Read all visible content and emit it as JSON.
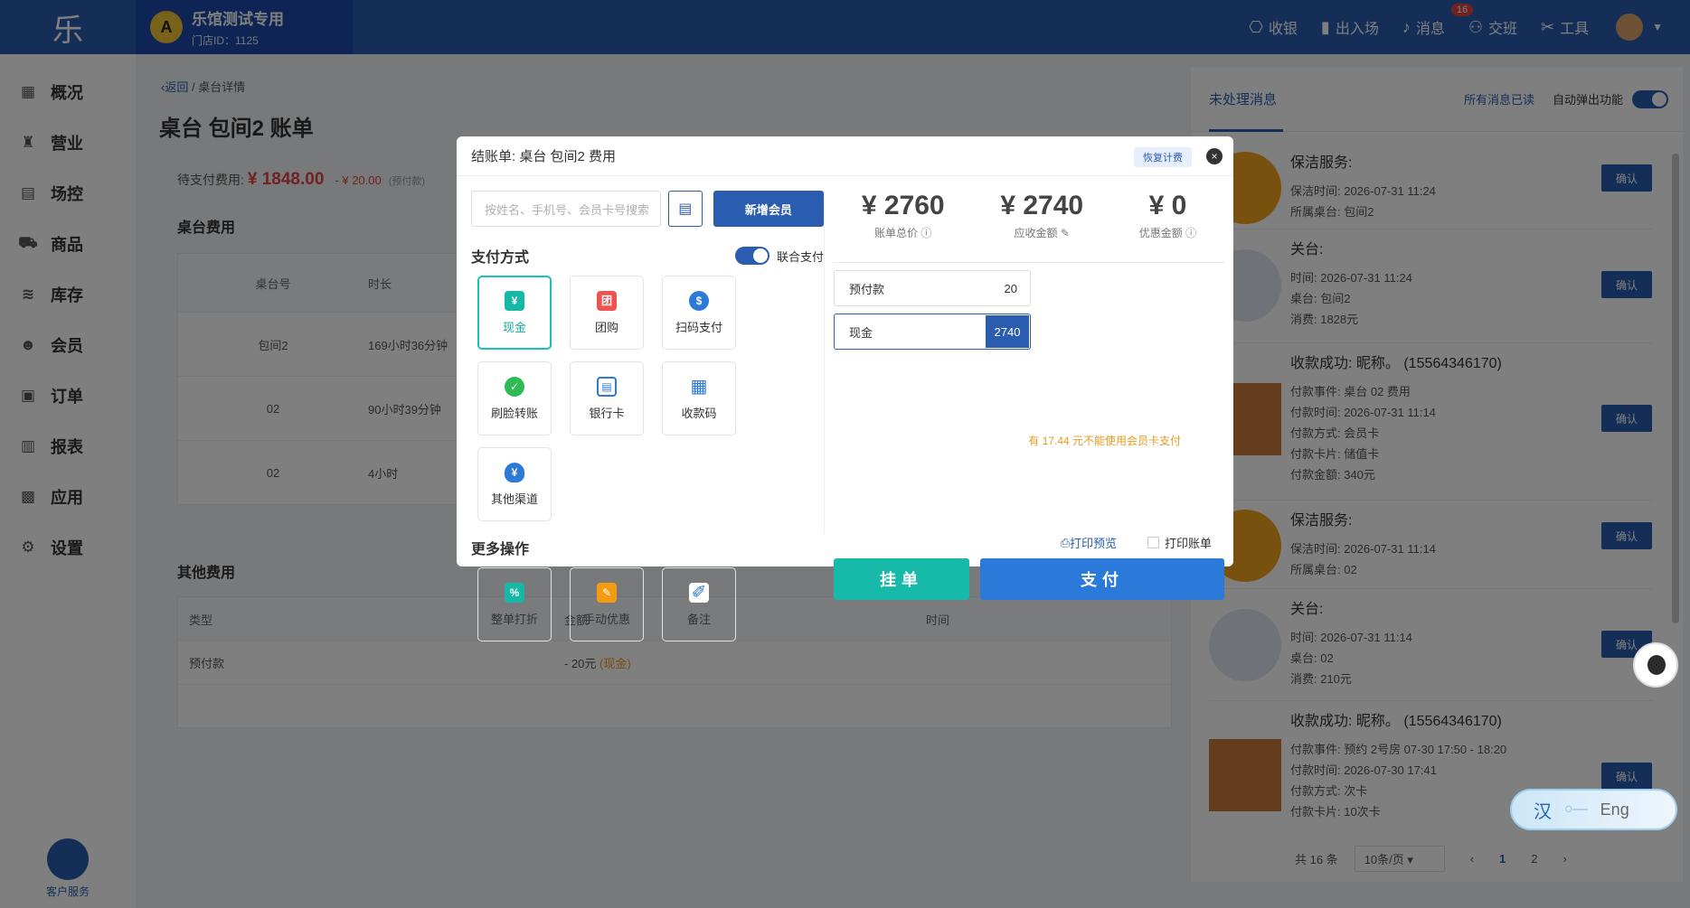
{
  "topbar": {
    "logo": "乐",
    "store_name": "乐馆测试专用",
    "store_id": "门店ID：1125",
    "tools": [
      {
        "label": "收银",
        "icon": "cash-register-icon",
        "glyph": "⎔"
      },
      {
        "label": "出入场",
        "icon": "door-icon",
        "glyph": "▮"
      },
      {
        "label": "消息",
        "icon": "bell-icon",
        "glyph": "🔔"
      },
      {
        "label": "交班",
        "icon": "handover-icon",
        "glyph": "⚇"
      },
      {
        "label": "工具",
        "icon": "tools-icon",
        "glyph": "✂"
      }
    ],
    "message_badge": "16"
  },
  "sidebar": {
    "items": [
      {
        "label": "概况",
        "icon": "chart-icon",
        "glyph": "▦"
      },
      {
        "label": "营业",
        "icon": "money-bag-icon",
        "glyph": "♜"
      },
      {
        "label": "场控",
        "icon": "control-icon",
        "glyph": "▤"
      },
      {
        "label": "商品",
        "icon": "cart-icon",
        "glyph": "⛟"
      },
      {
        "label": "库存",
        "icon": "layers-icon",
        "glyph": "≋"
      },
      {
        "label": "会员",
        "icon": "members-icon",
        "glyph": "☻"
      },
      {
        "label": "订单",
        "icon": "order-icon",
        "glyph": "▣"
      },
      {
        "label": "报表",
        "icon": "report-icon",
        "glyph": "▥"
      },
      {
        "label": "应用",
        "icon": "apps-icon",
        "glyph": "▩"
      },
      {
        "label": "设置",
        "icon": "gear-icon",
        "glyph": "⚙"
      }
    ],
    "customer_service": "客户服务"
  },
  "main": {
    "back": "返回",
    "crumb_current": "桌台详情",
    "title": "桌台 包间2 账单",
    "pending_label": "待支付费用:",
    "pending_amount": "¥ 1848.00",
    "prepaid_discount": "- ¥ 20.00",
    "prepaid_tag": "(预付款)",
    "table_fee_title": "桌台费用",
    "table_headers": [
      "桌台号",
      "时长"
    ],
    "table_rows": [
      {
        "table": "包间2",
        "duration": "169小时36分钟"
      },
      {
        "table": "02",
        "duration": "90小时39分钟"
      },
      {
        "table": "02",
        "duration": "4小时"
      }
    ],
    "other_fee_title": "其他费用",
    "other_headers": [
      "类型",
      "金额",
      "时间"
    ],
    "other_rows": [
      {
        "type": "预付款",
        "amount": "- 20元",
        "method": "(现金)"
      }
    ]
  },
  "right": {
    "tab": "未处理消息",
    "read_all": "所有消息已读",
    "auto_popup": "自动弹出功能",
    "messages": [
      {
        "title": "保洁服务:",
        "avatar": "home-icon",
        "lines": [
          "保洁时间:  2026-07-31 11:24",
          "所属桌台:  包间2"
        ],
        "btn": "确认"
      },
      {
        "title": "关台:",
        "avatar": "user-icon",
        "lines": [
          "时间:  2026-07-31 11:24",
          "桌台:  包间2",
          "消费:  1828元"
        ],
        "btn": "确认"
      },
      {
        "title": "收款成功:  昵称。  (15564346170)",
        "avatar": "cat-avatar-icon",
        "lines": [
          "付款事件:  桌台 02 费用",
          "付款时间:  2026-07-31 11:14",
          "付款方式:  会员卡",
          "付款卡片:  储值卡",
          "付款金额:  340元"
        ],
        "btn": "确认"
      },
      {
        "title": "保洁服务:",
        "avatar": "home-icon",
        "lines": [
          "保洁时间:  2026-07-31 11:14",
          "所属桌台:  02"
        ],
        "btn": "确认"
      },
      {
        "title": "关台:",
        "avatar": "user-icon",
        "lines": [
          "时间:  2026-07-31 11:14",
          "桌台:  02",
          "消费:  210元"
        ],
        "btn": "确认"
      },
      {
        "title": "收款成功:  昵称。  (15564346170)",
        "avatar": "cat-avatar-icon",
        "lines": [
          "付款事件:  预约 2号房 07-30 17:50 - 18:20",
          "付款时间:  2026-07-30 17:41",
          "付款方式:  次卡",
          "付款卡片:  10次卡"
        ],
        "btn": "确认"
      }
    ],
    "pager": {
      "total": "共 16 条",
      "size": "10条/页",
      "prev": "‹",
      "pages": [
        "1",
        "2"
      ],
      "next": "›"
    }
  },
  "modal": {
    "title": "结账单:  桌台 包间2 费用",
    "restore": "恢复计费",
    "close": "×",
    "search_placeholder": "按姓名、手机号、会员卡号搜索",
    "add_member": "新增会员",
    "pay_method_label": "支付方式",
    "combined_pay": "联合支付",
    "methods": [
      {
        "label": "现金",
        "icon": "cash-icon",
        "glyph": "¥",
        "color": "#16b9a8",
        "active": true
      },
      {
        "label": "团购",
        "icon": "group-buy-icon",
        "glyph": "团",
        "color": "#ef5350",
        "active": false
      },
      {
        "label": "扫码支付",
        "icon": "scan-pay-icon",
        "glyph": "$",
        "color": "#2b79d9",
        "active": false
      },
      {
        "label": "刷脸转账",
        "icon": "wechat-icon",
        "glyph": "✓",
        "color": "#2dbb55",
        "active": false
      },
      {
        "label": "银行卡",
        "icon": "bank-card-icon",
        "glyph": "▤",
        "color": "#2b79d9",
        "active": false
      },
      {
        "label": "收款码",
        "icon": "qr-code-icon",
        "glyph": "▦",
        "color": "#2b79d9",
        "active": false
      },
      {
        "label": "其他渠道",
        "icon": "money-bag-icon",
        "glyph": "¥",
        "color": "#2b79d9",
        "active": false
      }
    ],
    "more_label": "更多操作",
    "more": [
      {
        "label": "整单打折",
        "icon": "discount-tag-icon",
        "glyph": "%",
        "color": "#16b9a8"
      },
      {
        "label": "手动优惠",
        "icon": "edit-icon",
        "glyph": "✎",
        "color": "#f39c12"
      },
      {
        "label": "备注",
        "icon": "pen-icon",
        "glyph": "✐",
        "color": "#2b79d9"
      }
    ],
    "sums": [
      {
        "value": "¥ 2760",
        "label": "账单总价 ⓘ"
      },
      {
        "value": "¥ 2740",
        "label": "应收金额 ✎"
      },
      {
        "value": "¥ 0",
        "label": "优惠金额 ⓘ"
      }
    ],
    "prepaid": {
      "label": "预付款",
      "value": "20"
    },
    "cash": {
      "label": "现金",
      "value": "2740"
    },
    "warning": "有 17.44 元不能使用会员卡支付",
    "print_preview": "打印预览",
    "print_bill": "打印账单",
    "hang": "挂单",
    "pay": "支付"
  },
  "ime": {
    "cn": "汉",
    "en": "Eng"
  }
}
